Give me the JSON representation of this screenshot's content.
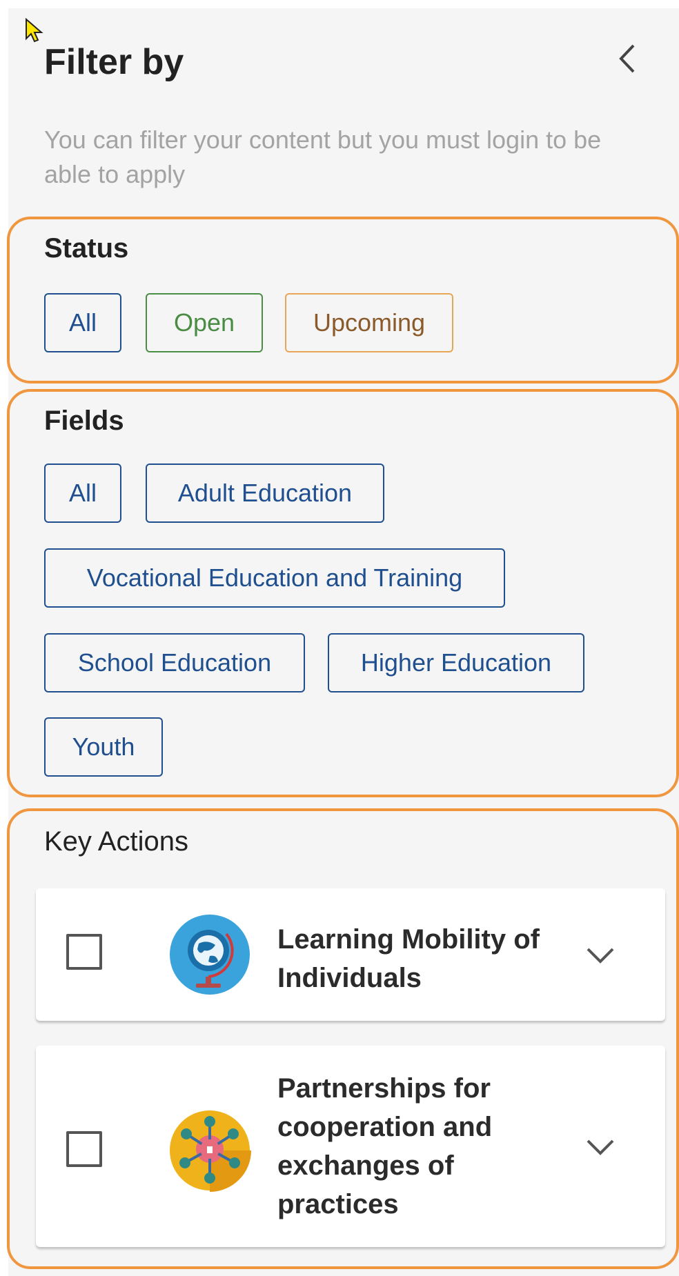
{
  "header": {
    "title": "Filter by",
    "back_icon": "chevron-left-icon",
    "subtitle": "You can filter your content but you must login to be able to apply"
  },
  "status": {
    "title": "Status",
    "options": [
      "All",
      "Open",
      "Upcoming"
    ]
  },
  "fields": {
    "title": "Fields",
    "options": [
      "All",
      "Adult Education",
      "Vocational Education and Training",
      "School Education",
      "Higher Education",
      "Youth"
    ]
  },
  "key_actions": {
    "title": "Key Actions",
    "items": [
      {
        "label": "Learning Mobility of Individuals",
        "icon": "globe-icon",
        "checked": false
      },
      {
        "label": "Partnerships for cooperation and exchanges of practices",
        "icon": "network-icon",
        "checked": false
      }
    ]
  },
  "colors": {
    "accent_outline": "#f0963f",
    "chip_blue": "#1f4f8e",
    "chip_open": "#4a8c44",
    "chip_upcoming": "#e9a556"
  }
}
